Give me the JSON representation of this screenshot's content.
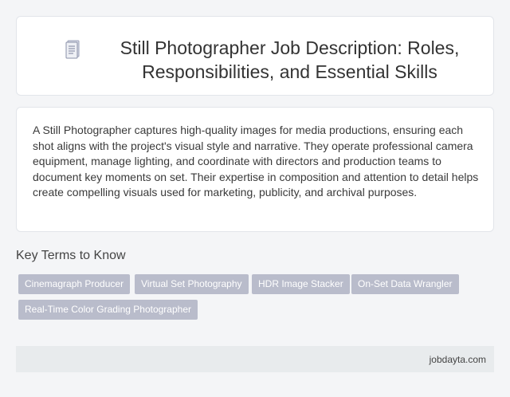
{
  "header": {
    "title": "Still Photographer Job Description: Roles, Responsibilities, and Essential Skills",
    "icon": "document-icon"
  },
  "description": {
    "text": "A Still Photographer captures high-quality images for media productions, ensuring each shot aligns with the project's visual style and narrative. They operate professional camera equipment, manage lighting, and coordinate with directors and production teams to document key moments on set. Their expertise in composition and attention to detail helps create compelling visuals used for marketing, publicity, and archival purposes."
  },
  "key_terms": {
    "heading": "Key Terms to Know",
    "tags": [
      "Cinemagraph Producer",
      "Virtual Set Photography",
      "HDR Image Stacker",
      "On-Set Data Wrangler",
      "Real-Time Color Grading Photographer"
    ]
  },
  "footer": {
    "site": "jobdayta.com"
  },
  "colors": {
    "background": "#f4f5f7",
    "tag_bg": "#b9bccb",
    "footer_bg": "#e8ebed"
  }
}
